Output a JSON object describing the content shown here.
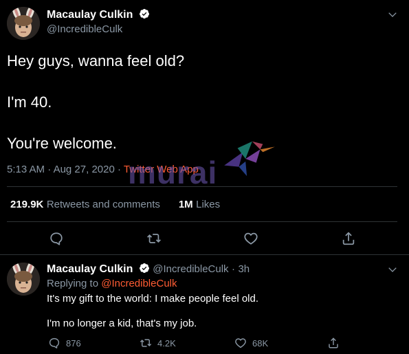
{
  "tweet": {
    "name": "Macaulay Culkin",
    "handle": "@IncredibleCulk",
    "lines": [
      "Hey guys, wanna feel old?",
      "I'm 40.",
      "You're welcome."
    ],
    "time": "5:13 AM",
    "sep": "·",
    "date": "Aug 27, 2020",
    "source": "Twitter Web App",
    "stats": {
      "retweets_num": "219.9K",
      "retweets_label": "Retweets and comments",
      "likes_num": "1M",
      "likes_label": "Likes"
    }
  },
  "reply": {
    "name": "Macaulay Culkin",
    "handle": "@IncredibleCulk",
    "sep": "·",
    "age": "3h",
    "replying_label": "Replying to",
    "replying_to": "@IncredibleCulk",
    "line1": "It's my gift to the world: I make people feel old.",
    "line2": "I'm no longer a kid, that's my job.",
    "counts": {
      "replies": "876",
      "retweets": "4.2K",
      "likes": "68K"
    }
  },
  "watermark": {
    "text": "murai"
  },
  "colors": {
    "accent": "#ff5c33",
    "muted": "#8b98a5",
    "background": "#000000"
  },
  "icons": [
    "verified-icon",
    "chevron-down-icon",
    "reply-icon",
    "retweet-icon",
    "like-icon",
    "share-icon",
    "hummingbird-icon"
  ]
}
